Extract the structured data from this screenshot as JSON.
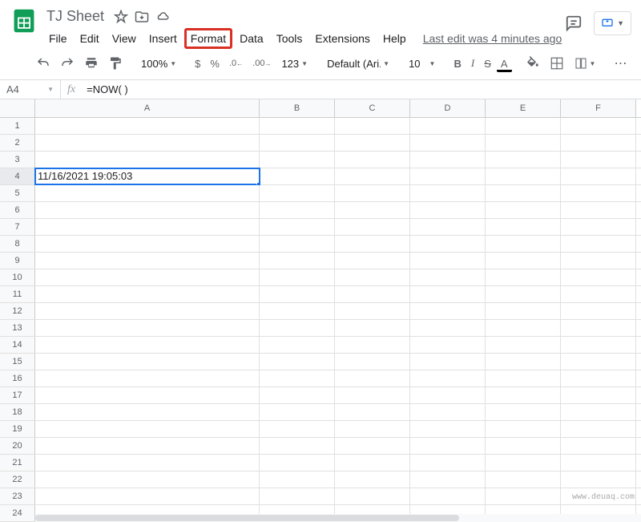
{
  "doc": {
    "title": "TJ Sheet"
  },
  "menu": {
    "items": [
      "File",
      "Edit",
      "View",
      "Insert",
      "Format",
      "Data",
      "Tools",
      "Extensions",
      "Help"
    ],
    "highlighted_index": 4,
    "last_edit": "Last edit was 4 minutes ago"
  },
  "toolbar": {
    "zoom": "100%",
    "currency": "$",
    "percent": "%",
    "dec_decrease": ".0",
    "dec_increase": ".00",
    "num_format": "123",
    "font": "Default (Ari...",
    "font_size": "10",
    "bold": "B",
    "italic": "I",
    "strike": "S",
    "text_color": "A",
    "more": "⋯"
  },
  "formula_bar": {
    "cell_ref": "A4",
    "fx": "fx",
    "formula": "=NOW( )"
  },
  "grid": {
    "columns": [
      "A",
      "B",
      "C",
      "D",
      "E",
      "F"
    ],
    "rows": 24,
    "active_cell": "A4",
    "cells": {
      "A4": "11/16/2021 19:05:03"
    }
  },
  "watermark": "www.deuaq.com"
}
